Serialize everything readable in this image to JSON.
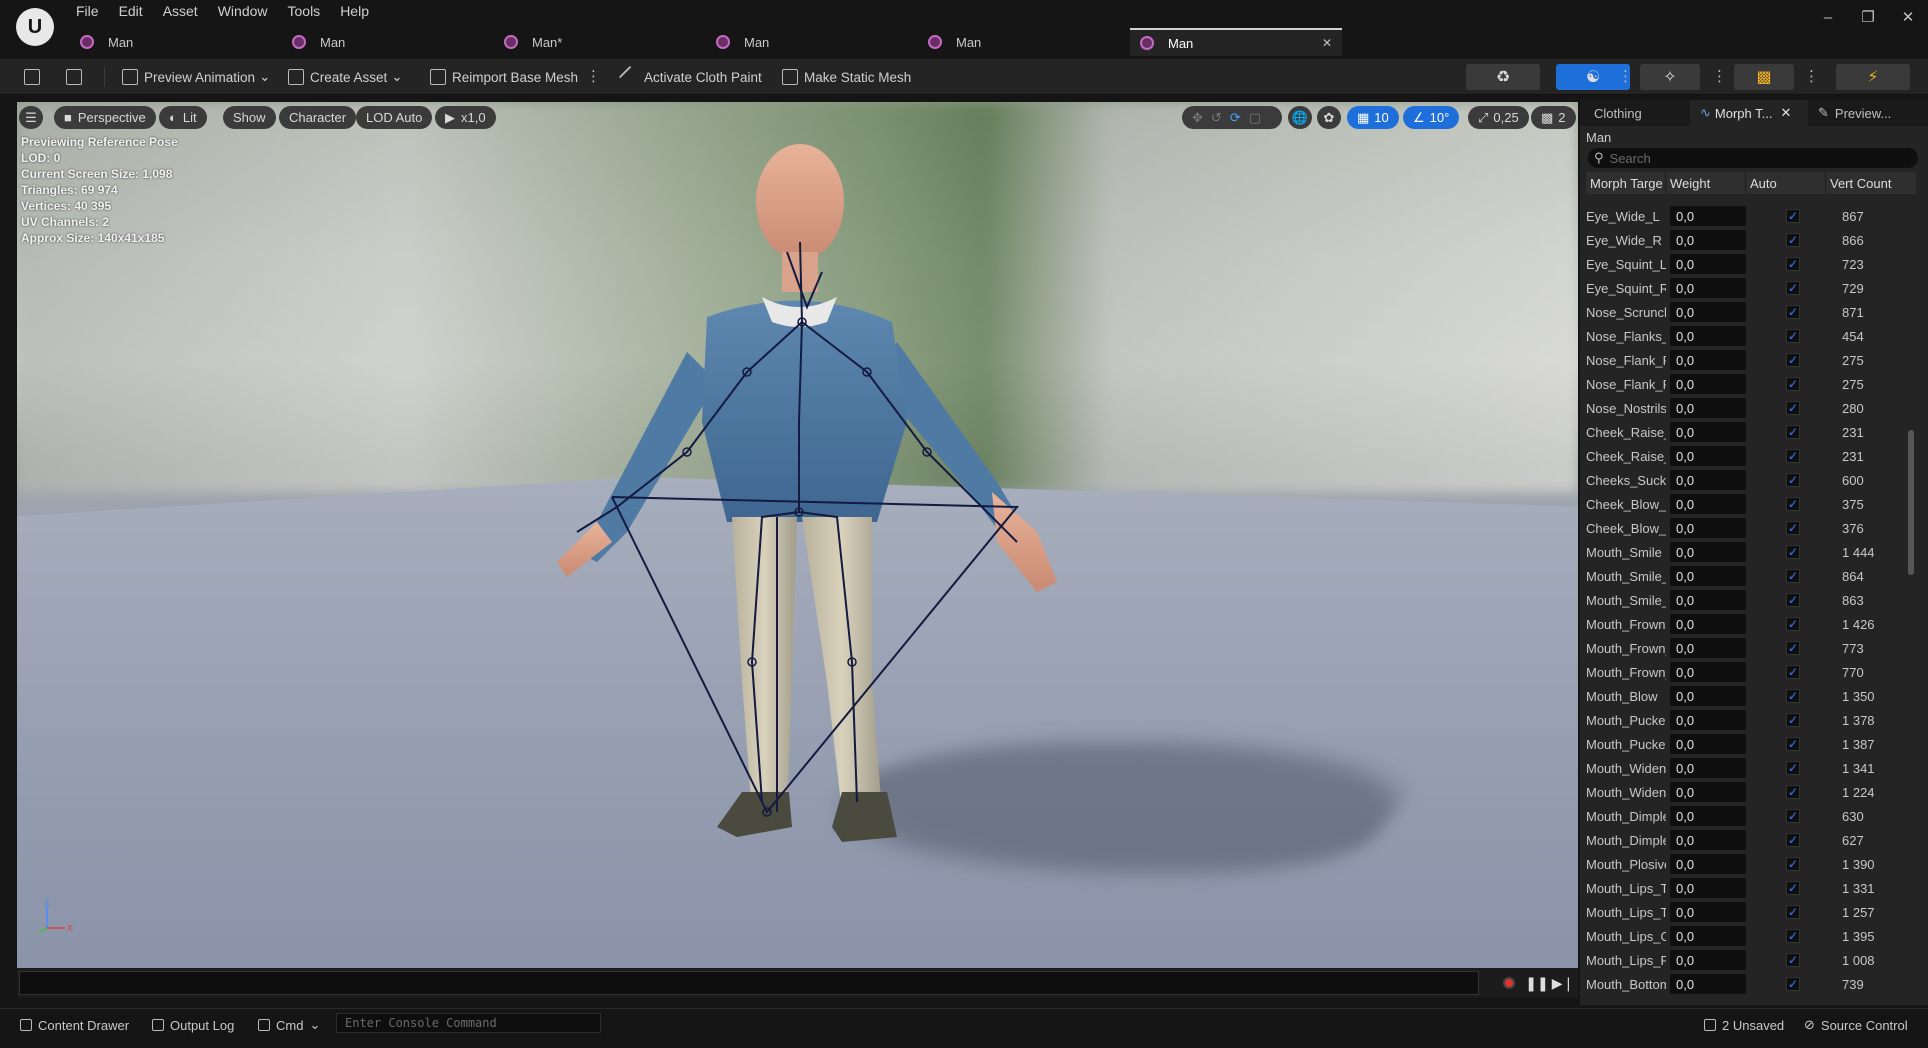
{
  "menu": [
    "File",
    "Edit",
    "Asset",
    "Window",
    "Tools",
    "Help"
  ],
  "tabs": [
    {
      "label": "Man",
      "active": false
    },
    {
      "label": "Man",
      "active": false
    },
    {
      "label": "Man*",
      "active": false
    },
    {
      "label": "Man",
      "active": false
    },
    {
      "label": "Man",
      "active": false
    },
    {
      "label": "Man",
      "active": true
    }
  ],
  "toolbar": {
    "preview_animation": "Preview Animation",
    "create_asset": "Create Asset",
    "reimport": "Reimport Base Mesh",
    "cloth_paint": "Activate Cloth Paint",
    "static_mesh": "Make Static Mesh"
  },
  "viewport": {
    "perspective": "Perspective",
    "lit": "Lit",
    "show": "Show",
    "character": "Character",
    "lod": "LOD Auto",
    "speed": "x1,0",
    "grid": "10",
    "angle": "10°",
    "scale": "0,25",
    "camera": "2",
    "stats": [
      "Previewing Reference Pose",
      "LOD: 0",
      "Current Screen Size: 1,098",
      "Triangles: 69 974",
      "Vertices: 40 395",
      "UV Channels: 2",
      "Approx Size: 140x41x185"
    ],
    "axis_z": "Z",
    "axis_x": "X"
  },
  "right_panel": {
    "tabs": [
      "Clothing",
      "Morph T...",
      "Preview..."
    ],
    "asset_name": "Man",
    "search_placeholder": "Search",
    "columns": [
      "Morph Targe",
      "Weight",
      "Auto",
      "Vert Count"
    ],
    "rows": [
      {
        "name": "Eye_Wide_L",
        "weight": "0,0",
        "auto": true,
        "count": "867"
      },
      {
        "name": "Eye_Wide_R",
        "weight": "0,0",
        "auto": true,
        "count": "866"
      },
      {
        "name": "Eye_Squint_L",
        "weight": "0,0",
        "auto": true,
        "count": "723"
      },
      {
        "name": "Eye_Squint_R",
        "weight": "0,0",
        "auto": true,
        "count": "729"
      },
      {
        "name": "Nose_Scrunch",
        "weight": "0,0",
        "auto": true,
        "count": "871"
      },
      {
        "name": "Nose_Flanks_",
        "weight": "0,0",
        "auto": true,
        "count": "454"
      },
      {
        "name": "Nose_Flank_R",
        "weight": "0,0",
        "auto": true,
        "count": "275"
      },
      {
        "name": "Nose_Flank_R",
        "weight": "0,0",
        "auto": true,
        "count": "275"
      },
      {
        "name": "Nose_Nostrils",
        "weight": "0,0",
        "auto": true,
        "count": "280"
      },
      {
        "name": "Cheek_Raise_",
        "weight": "0,0",
        "auto": true,
        "count": "231"
      },
      {
        "name": "Cheek_Raise_",
        "weight": "0,0",
        "auto": true,
        "count": "231"
      },
      {
        "name": "Cheeks_Suck",
        "weight": "0,0",
        "auto": true,
        "count": "600"
      },
      {
        "name": "Cheek_Blow_L",
        "weight": "0,0",
        "auto": true,
        "count": "375"
      },
      {
        "name": "Cheek_Blow_R",
        "weight": "0,0",
        "auto": true,
        "count": "376"
      },
      {
        "name": "Mouth_Smile",
        "weight": "0,0",
        "auto": true,
        "count": "1 444"
      },
      {
        "name": "Mouth_Smile_",
        "weight": "0,0",
        "auto": true,
        "count": "864"
      },
      {
        "name": "Mouth_Smile_",
        "weight": "0,0",
        "auto": true,
        "count": "863"
      },
      {
        "name": "Mouth_Frown",
        "weight": "0,0",
        "auto": true,
        "count": "1 426"
      },
      {
        "name": "Mouth_Frown_",
        "weight": "0,0",
        "auto": true,
        "count": "773"
      },
      {
        "name": "Mouth_Frown_",
        "weight": "0,0",
        "auto": true,
        "count": "770"
      },
      {
        "name": "Mouth_Blow",
        "weight": "0,0",
        "auto": true,
        "count": "1 350"
      },
      {
        "name": "Mouth_Pucker",
        "weight": "0,0",
        "auto": true,
        "count": "1 378"
      },
      {
        "name": "Mouth_Pucker",
        "weight": "0,0",
        "auto": true,
        "count": "1 387"
      },
      {
        "name": "Mouth_Widen",
        "weight": "0,0",
        "auto": true,
        "count": "1 341"
      },
      {
        "name": "Mouth_Widen_",
        "weight": "0,0",
        "auto": true,
        "count": "1 224"
      },
      {
        "name": "Mouth_Dimple",
        "weight": "0,0",
        "auto": true,
        "count": "630"
      },
      {
        "name": "Mouth_Dimple",
        "weight": "0,0",
        "auto": true,
        "count": "627"
      },
      {
        "name": "Mouth_Plosive",
        "weight": "0,0",
        "auto": true,
        "count": "1 390"
      },
      {
        "name": "Mouth_Lips_T",
        "weight": "0,0",
        "auto": true,
        "count": "1 331"
      },
      {
        "name": "Mouth_Lips_T",
        "weight": "0,0",
        "auto": true,
        "count": "1 257"
      },
      {
        "name": "Mouth_Lips_O",
        "weight": "0,0",
        "auto": true,
        "count": "1 395"
      },
      {
        "name": "Mouth_Lips_P",
        "weight": "0,0",
        "auto": true,
        "count": "1 008"
      },
      {
        "name": "Mouth_Bottom",
        "weight": "0,0",
        "auto": true,
        "count": "739"
      }
    ]
  },
  "status": {
    "content_drawer": "Content Drawer",
    "output_log": "Output Log",
    "cmd": "Cmd",
    "console_placeholder": "Enter Console Command",
    "unsaved": "2 Unsaved",
    "source_control": "Source Control"
  },
  "colors": {
    "accent": "#1e6fd9",
    "checkbox": "#2f82ff",
    "asset_icon": "#c46bbf"
  }
}
